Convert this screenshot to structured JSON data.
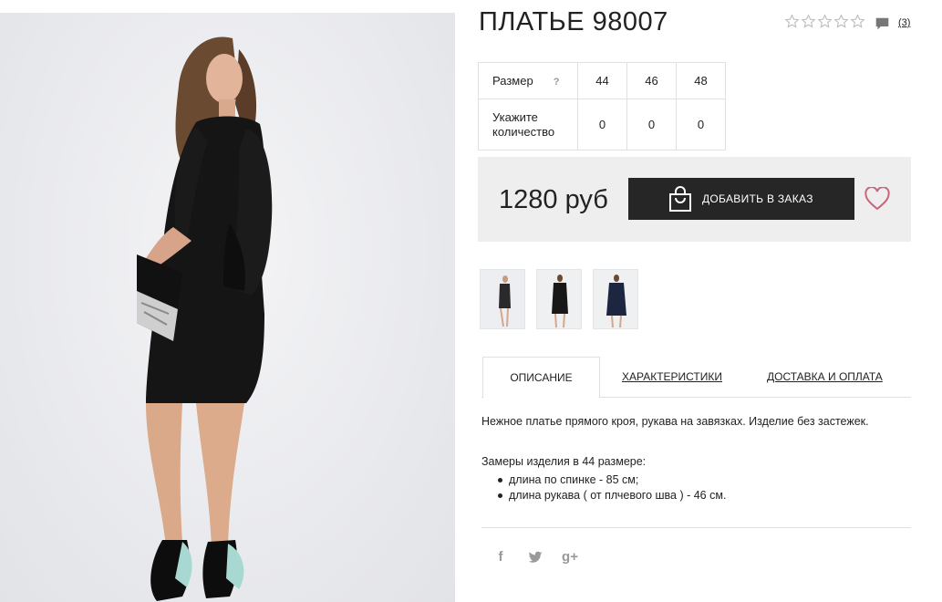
{
  "product": {
    "title": "ПЛАТЬЕ 98007",
    "reviews_count": "(3)",
    "rating_stars": 0,
    "price": "1280 руб"
  },
  "icons": {
    "rating": "star-outline-icon",
    "reviews": "comment-icon",
    "cart": "shopping-bag-icon",
    "favorite": "heart-icon"
  },
  "sizes": {
    "size_label": "Размер",
    "help_label": "?",
    "quantity_label_line1": "Укажите",
    "quantity_label_line2": "количество",
    "columns": [
      "44",
      "46",
      "48"
    ],
    "quantities": [
      "0",
      "0",
      "0"
    ]
  },
  "buy": {
    "add_button_label": "ДОБАВИТЬ В ЗАКАЗ"
  },
  "tabs": [
    {
      "label": "ОПИСАНИЕ",
      "active": true
    },
    {
      "label": "ХАРАКТЕРИСТИКИ",
      "active": false
    },
    {
      "label": "ДОСТАВКА И ОПЛАТА",
      "active": false
    }
  ],
  "description": {
    "text": "Нежное платье прямого кроя, рукава на завязках. Изделие без застежек.",
    "measures_title": "Замеры изделия в 44 размере:",
    "measures": [
      "длина по спинке - 85 см;",
      "длина рукава ( от плчевого шва ) - 46 см."
    ]
  },
  "social": {
    "facebook": "f",
    "twitter": "twitter-icon",
    "google_plus": "g+"
  },
  "colors": {
    "button_bg": "#262626",
    "buybox_bg": "#eeeeee",
    "heart": "#c9647a",
    "star_outline": "#bbbbbb",
    "social": "#999999"
  }
}
